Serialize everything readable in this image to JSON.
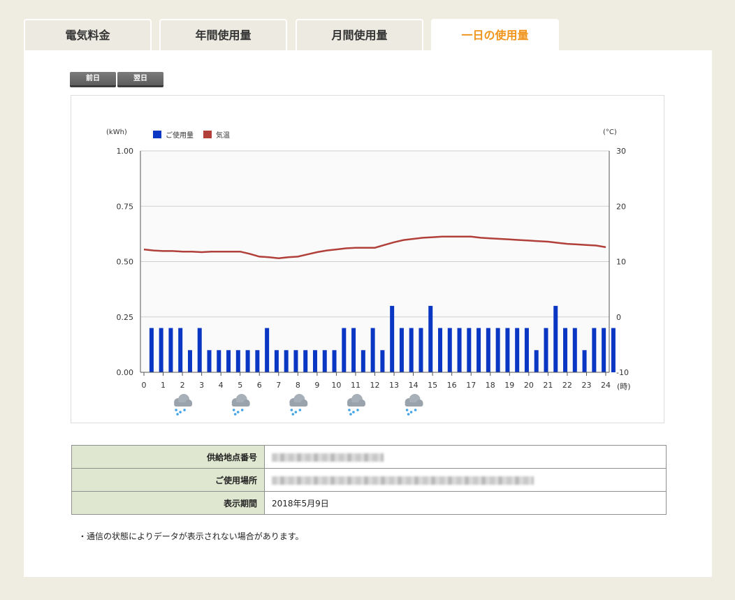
{
  "tabs": [
    {
      "label": "電気料金",
      "active": false
    },
    {
      "label": "年間使用量",
      "active": false
    },
    {
      "label": "月間使用量",
      "active": false
    },
    {
      "label": "一日の使用量",
      "active": true
    }
  ],
  "nav": {
    "prev_label": "前日",
    "next_label": "翌日"
  },
  "chart_data": {
    "type": "bar",
    "left_unit": "(kWh)",
    "right_unit": "(°C)",
    "x_unit": "(時)",
    "legend": {
      "usage": "ご使用量",
      "temperature": "気温"
    },
    "ylim": [
      0,
      1.0
    ],
    "yticks": [
      "0.00",
      "0.25",
      "0.50",
      "0.75",
      "1.00"
    ],
    "y2lim": [
      -10,
      30
    ],
    "y2ticks": [
      "-10",
      "0",
      "10",
      "20",
      "30"
    ],
    "xticks": [
      "0",
      "1",
      "2",
      "3",
      "4",
      "5",
      "6",
      "7",
      "8",
      "9",
      "10",
      "11",
      "12",
      "13",
      "14",
      "15",
      "16",
      "17",
      "18",
      "19",
      "20",
      "21",
      "22",
      "23",
      "24"
    ],
    "usage_half_hourly": [
      0.2,
      0.2,
      0.2,
      0.2,
      0.1,
      0.2,
      0.1,
      0.1,
      0.1,
      0.1,
      0.1,
      0.1,
      0.2,
      0.1,
      0.1,
      0.1,
      0.1,
      0.1,
      0.1,
      0.1,
      0.2,
      0.2,
      0.1,
      0.2,
      0.1,
      0.3,
      0.2,
      0.2,
      0.2,
      0.3,
      0.2,
      0.2,
      0.2,
      0.2,
      0.2,
      0.2,
      0.2,
      0.2,
      0.2,
      0.2,
      0.1,
      0.2,
      0.3,
      0.2,
      0.2,
      0.1,
      0.2,
      0.2,
      0.2
    ],
    "temperature_half_hourly": [
      12.2,
      12.0,
      11.9,
      11.9,
      11.8,
      11.8,
      11.7,
      11.8,
      11.8,
      11.8,
      11.8,
      11.4,
      10.9,
      10.8,
      10.6,
      10.8,
      10.9,
      11.3,
      11.7,
      12.0,
      12.2,
      12.4,
      12.5,
      12.5,
      12.5,
      13.0,
      13.5,
      13.9,
      14.1,
      14.3,
      14.4,
      14.5,
      14.5,
      14.5,
      14.5,
      14.3,
      14.2,
      14.1,
      14.0,
      13.9,
      13.8,
      13.7,
      13.6,
      13.4,
      13.2,
      13.1,
      13.0,
      12.9,
      12.6
    ],
    "weather": [
      "rain",
      "rain",
      "rain",
      "rain",
      "rain"
    ],
    "colors": {
      "usage": "#0a36c4",
      "temperature": "#b13f3a"
    }
  },
  "info": {
    "rows": [
      {
        "label": "供給地点番号",
        "value": ""
      },
      {
        "label": "ご使用場所",
        "value": ""
      },
      {
        "label": "表示期間",
        "value": "2018年5月9日"
      }
    ]
  },
  "note": "・通信の状態によりデータが表示されない場合があります。"
}
